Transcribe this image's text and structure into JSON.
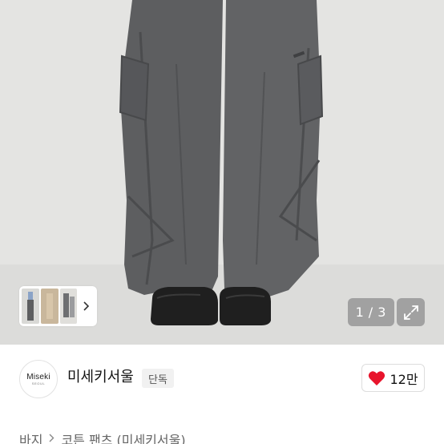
{
  "gallery": {
    "current_page": "1",
    "separator": "/",
    "total_pages": "3",
    "thumbnails": [
      "thumbnail-1",
      "thumbnail-2",
      "thumbnail-3"
    ]
  },
  "brand": {
    "logo_text": "Miseki",
    "logo_subtext": "SEOUL",
    "name": "미세키서울",
    "badge": "단독"
  },
  "like": {
    "count": "12만",
    "color": "#e8142c"
  },
  "breadcrumb": {
    "category": "바지",
    "item": "코튼 팬츠 (미세키서울)"
  },
  "colors": {
    "pants": "#5d5e60",
    "background": "#e4e4e2",
    "shoes": "#1f1f1f"
  }
}
